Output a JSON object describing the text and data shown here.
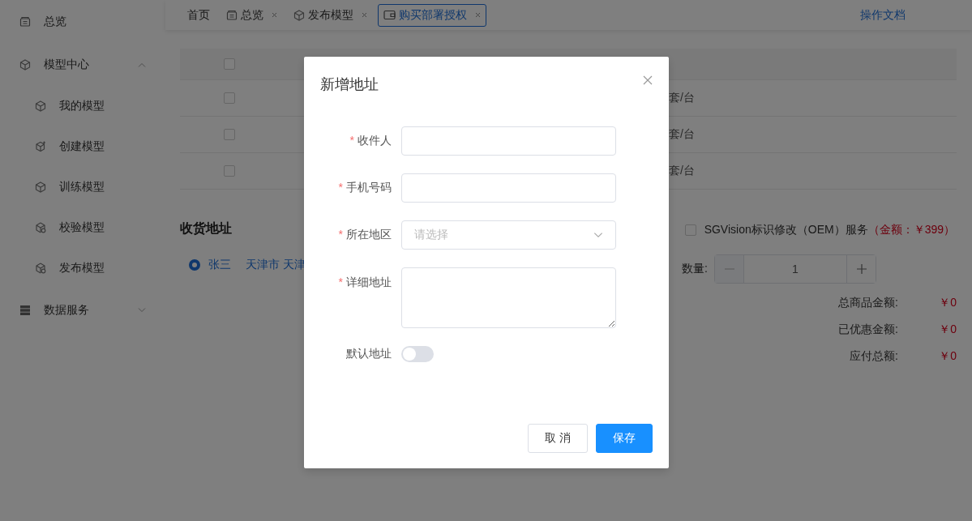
{
  "sidebar": {
    "items": [
      {
        "label": "总览",
        "kind": "link"
      },
      {
        "label": "模型中心",
        "kind": "group",
        "expanded": true,
        "children": [
          {
            "label": "我的模型"
          },
          {
            "label": "创建模型"
          },
          {
            "label": "训练模型"
          },
          {
            "label": "校验模型"
          },
          {
            "label": "发布模型"
          }
        ]
      },
      {
        "label": "数据服务",
        "kind": "group",
        "expanded": false
      }
    ]
  },
  "tabs": [
    {
      "label": "首页",
      "selected": false,
      "closable": false
    },
    {
      "label": "总览",
      "selected": false,
      "closable": true
    },
    {
      "label": "发布模型",
      "selected": false,
      "closable": true
    },
    {
      "label": "购买部署授权",
      "selected": true,
      "closable": true
    }
  ],
  "help_link": "操作文档",
  "table": {
    "header_checked": false,
    "rows": [
      {
        "checked": false,
        "unit": "套/台"
      },
      {
        "checked": false,
        "unit": "套/台"
      },
      {
        "checked": false,
        "unit": "套/台"
      }
    ]
  },
  "shipping": {
    "title": "收货地址",
    "address": {
      "selected": true,
      "name": "张三",
      "location": "天津市 天津"
    }
  },
  "oem": {
    "checked": false,
    "label": "SGVision标识修改（OEM）服务",
    "price": "（金额：￥399）"
  },
  "quantity": {
    "label": "数量:",
    "value": "1",
    "decrement_disabled": true
  },
  "totals": [
    {
      "label": "总商品金额:",
      "value": "￥0"
    },
    {
      "label": "已优惠金额:",
      "value": "￥0"
    },
    {
      "label": "应付总额:",
      "value": "￥0"
    }
  ],
  "dialog": {
    "title": "新增地址",
    "required_mark": "*",
    "fields": [
      {
        "kind": "input",
        "label": "收件人",
        "required": true
      },
      {
        "kind": "input",
        "label": "手机号码",
        "required": true
      },
      {
        "kind": "select",
        "label": "所在地区",
        "required": true,
        "placeholder": "请选择"
      },
      {
        "kind": "textarea",
        "label": "详细地址",
        "required": true
      },
      {
        "kind": "switch",
        "label": "默认地址",
        "required": false,
        "on": false
      }
    ],
    "buttons": [
      {
        "label": "取 消",
        "kind": "default"
      },
      {
        "label": "保存",
        "kind": "primary"
      }
    ]
  }
}
